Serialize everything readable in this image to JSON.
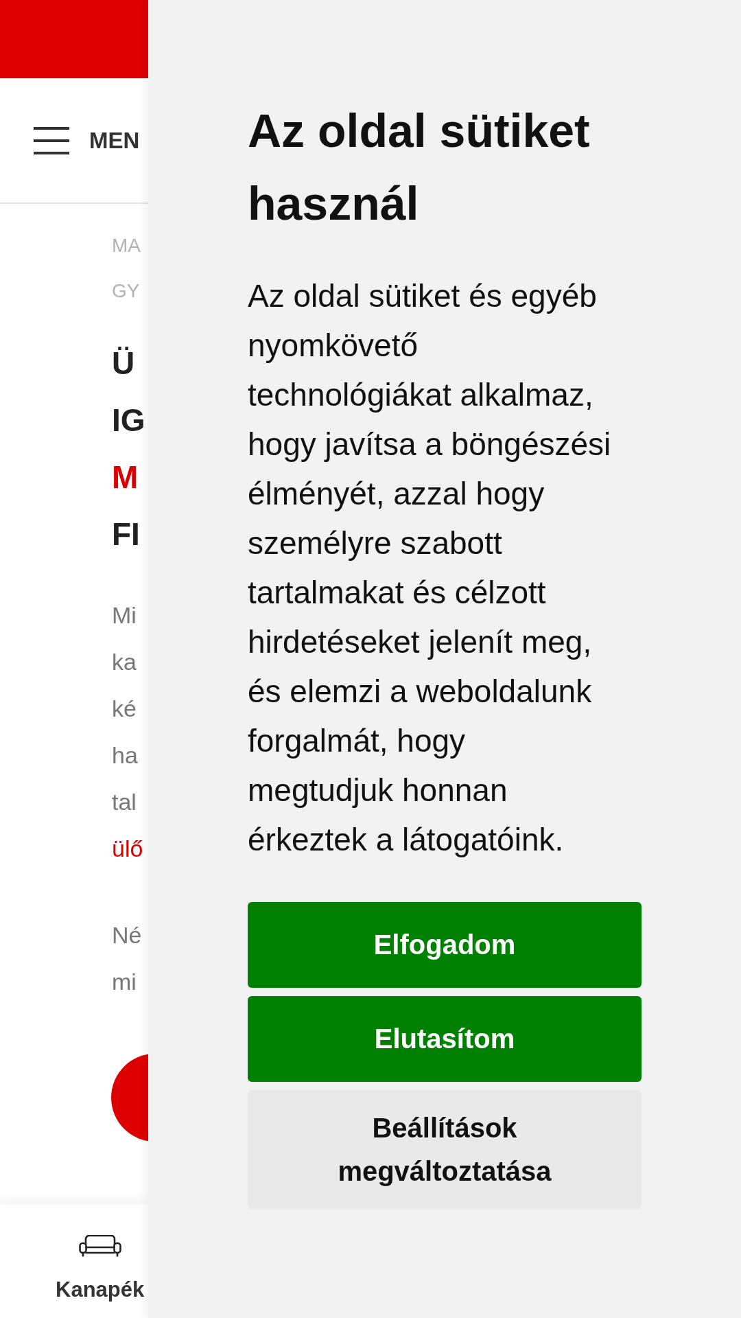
{
  "site": {
    "header": {
      "menu_label": "MEN"
    },
    "breadcrumb": [
      "MA",
      "GY"
    ],
    "heading_lines": [
      {
        "text": "Ü",
        "kind": "plain"
      },
      {
        "text": "IG",
        "kind": "plain"
      },
      {
        "text": "M",
        "kind": "accent"
      },
      {
        "text": "FI",
        "kind": "plain"
      }
    ],
    "intro_lines": [
      {
        "text": "Mi",
        "kind": "plain"
      },
      {
        "text": "ka",
        "kind": "plain"
      },
      {
        "text": "ké",
        "kind": "plain"
      },
      {
        "text": "ha",
        "kind": "plain"
      },
      {
        "text": "tal",
        "kind": "plain"
      },
      {
        "text": "ülő",
        "kind": "link"
      }
    ],
    "second_lines": [
      "Né",
      "mi"
    ],
    "bottom_nav": [
      {
        "label": "Kanapék"
      }
    ]
  },
  "cookie_panel": {
    "title": "Az oldal sütiket használ",
    "body": "Az oldal sütiket és egyéb\nnyomkövető\ntechnológiákat alkalmaz,\nhogy javítsa a böngészési\nélményét, azzal hogy\nszemélyre szabott\ntartalmakat és célzott\nhirdetéseket jelenít meg,\nés elemzi a weboldalunk\nforgalmát, hogy\nmegtudjuk honnan\nérkeztek a látogatóink.",
    "buttons": [
      {
        "label": "Elfogadom",
        "kind": "primary"
      },
      {
        "label": "Elutasítom",
        "kind": "primary"
      },
      {
        "label": "Beállítások megváltoztatása",
        "kind": "secondary"
      }
    ]
  }
}
